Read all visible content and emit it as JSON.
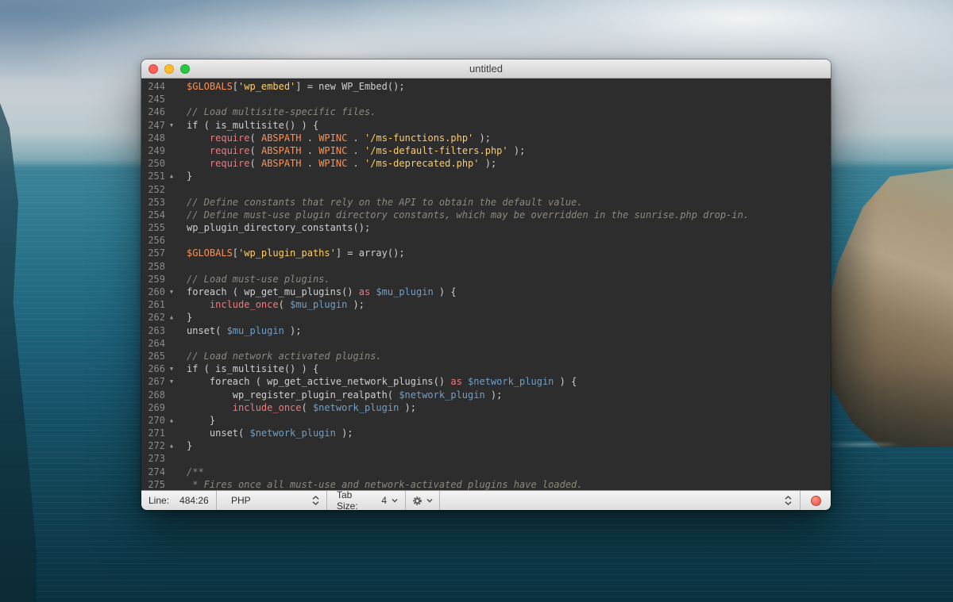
{
  "window": {
    "title": "untitled"
  },
  "editor": {
    "colors": {
      "background": "#2d2d2d",
      "foreground": "#cfcfcf",
      "comment": "#8d887c",
      "string": "#ffcc66",
      "keyword": "#f2777a",
      "constant": "#f99157",
      "variable": "#6f9fc8",
      "line_number": "#8a8a8a",
      "fold_marker": "#9a9a9a"
    },
    "lines": [
      {
        "n": 244,
        "fold": "",
        "seg": [
          [
            "$GLOBALS",
            "o"
          ],
          [
            "[",
            "f"
          ],
          [
            "'wp_embed'",
            "s"
          ],
          [
            "] = new WP_Embed();",
            "f"
          ]
        ]
      },
      {
        "n": 245,
        "fold": "",
        "seg": []
      },
      {
        "n": 246,
        "fold": "",
        "seg": [
          [
            "// Load multisite-specific files.",
            "c"
          ]
        ]
      },
      {
        "n": 247,
        "fold": "down",
        "seg": [
          [
            "if ( is_multisite() ) {",
            "f"
          ]
        ]
      },
      {
        "n": 248,
        "fold": "",
        "seg": [
          [
            "    ",
            "f"
          ],
          [
            "require",
            "k"
          ],
          [
            "( ",
            "f"
          ],
          [
            "ABSPATH",
            "o"
          ],
          [
            " . ",
            "f"
          ],
          [
            "WPINC",
            "o"
          ],
          [
            " . ",
            "f"
          ],
          [
            "'/ms-functions.php'",
            "s"
          ],
          [
            " );",
            "f"
          ]
        ]
      },
      {
        "n": 249,
        "fold": "",
        "seg": [
          [
            "    ",
            "f"
          ],
          [
            "require",
            "k"
          ],
          [
            "( ",
            "f"
          ],
          [
            "ABSPATH",
            "o"
          ],
          [
            " . ",
            "f"
          ],
          [
            "WPINC",
            "o"
          ],
          [
            " . ",
            "f"
          ],
          [
            "'/ms-default-filters.php'",
            "s"
          ],
          [
            " );",
            "f"
          ]
        ]
      },
      {
        "n": 250,
        "fold": "",
        "seg": [
          [
            "    ",
            "f"
          ],
          [
            "require",
            "k"
          ],
          [
            "( ",
            "f"
          ],
          [
            "ABSPATH",
            "o"
          ],
          [
            " . ",
            "f"
          ],
          [
            "WPINC",
            "o"
          ],
          [
            " . ",
            "f"
          ],
          [
            "'/ms-deprecated.php'",
            "s"
          ],
          [
            " );",
            "f"
          ]
        ]
      },
      {
        "n": 251,
        "fold": "up",
        "seg": [
          [
            "}",
            "f"
          ]
        ]
      },
      {
        "n": 252,
        "fold": "",
        "seg": []
      },
      {
        "n": 253,
        "fold": "",
        "seg": [
          [
            "// Define constants that rely on the API to obtain the default value.",
            "c"
          ]
        ]
      },
      {
        "n": 254,
        "fold": "",
        "seg": [
          [
            "// Define must-use plugin directory constants, which may be overridden in the sunrise.php drop-in.",
            "c"
          ]
        ]
      },
      {
        "n": 255,
        "fold": "",
        "seg": [
          [
            "wp_plugin_directory_constants();",
            "f"
          ]
        ]
      },
      {
        "n": 256,
        "fold": "",
        "seg": []
      },
      {
        "n": 257,
        "fold": "",
        "seg": [
          [
            "$GLOBALS",
            "o"
          ],
          [
            "[",
            "f"
          ],
          [
            "'wp_plugin_paths'",
            "s"
          ],
          [
            "] = array();",
            "f"
          ]
        ]
      },
      {
        "n": 258,
        "fold": "",
        "seg": []
      },
      {
        "n": 259,
        "fold": "",
        "seg": [
          [
            "// Load must-use plugins.",
            "c"
          ]
        ]
      },
      {
        "n": 260,
        "fold": "down",
        "seg": [
          [
            "foreach ( wp_get_mu_plugins() ",
            "f"
          ],
          [
            "as",
            "k"
          ],
          [
            " ",
            "f"
          ],
          [
            "$mu_plugin",
            "v"
          ],
          [
            " ) {",
            "f"
          ]
        ]
      },
      {
        "n": 261,
        "fold": "",
        "seg": [
          [
            "    ",
            "f"
          ],
          [
            "include_once",
            "k"
          ],
          [
            "( ",
            "f"
          ],
          [
            "$mu_plugin",
            "v"
          ],
          [
            " );",
            "f"
          ]
        ]
      },
      {
        "n": 262,
        "fold": "up",
        "seg": [
          [
            "}",
            "f"
          ]
        ]
      },
      {
        "n": 263,
        "fold": "",
        "seg": [
          [
            "unset( ",
            "f"
          ],
          [
            "$mu_plugin",
            "v"
          ],
          [
            " );",
            "f"
          ]
        ]
      },
      {
        "n": 264,
        "fold": "",
        "seg": []
      },
      {
        "n": 265,
        "fold": "",
        "seg": [
          [
            "// Load network activated plugins.",
            "c"
          ]
        ]
      },
      {
        "n": 266,
        "fold": "down",
        "seg": [
          [
            "if ( is_multisite() ) {",
            "f"
          ]
        ]
      },
      {
        "n": 267,
        "fold": "down",
        "seg": [
          [
            "    foreach ( wp_get_active_network_plugins() ",
            "f"
          ],
          [
            "as",
            "k"
          ],
          [
            " ",
            "f"
          ],
          [
            "$network_plugin",
            "v"
          ],
          [
            " ) {",
            "f"
          ]
        ]
      },
      {
        "n": 268,
        "fold": "",
        "seg": [
          [
            "        wp_register_plugin_realpath( ",
            "f"
          ],
          [
            "$network_plugin",
            "v"
          ],
          [
            " );",
            "f"
          ]
        ]
      },
      {
        "n": 269,
        "fold": "",
        "seg": [
          [
            "        ",
            "f"
          ],
          [
            "include_once",
            "k"
          ],
          [
            "( ",
            "f"
          ],
          [
            "$network_plugin",
            "v"
          ],
          [
            " );",
            "f"
          ]
        ]
      },
      {
        "n": 270,
        "fold": "up",
        "seg": [
          [
            "    }",
            "f"
          ]
        ]
      },
      {
        "n": 271,
        "fold": "",
        "seg": [
          [
            "    unset( ",
            "f"
          ],
          [
            "$network_plugin",
            "v"
          ],
          [
            " );",
            "f"
          ]
        ]
      },
      {
        "n": 272,
        "fold": "up",
        "seg": [
          [
            "}",
            "f"
          ]
        ]
      },
      {
        "n": 273,
        "fold": "",
        "seg": []
      },
      {
        "n": 274,
        "fold": "",
        "seg": [
          [
            "/**",
            "c"
          ]
        ]
      },
      {
        "n": 275,
        "fold": "",
        "seg": [
          [
            " * Fires once all must-use and network-activated plugins have loaded.",
            "c"
          ]
        ]
      }
    ]
  },
  "status_bar": {
    "line_label": "Line:",
    "line_value": "484:26",
    "language": "PHP",
    "tab_size_label": "Tab Size:",
    "tab_size_value": "4",
    "indicator_color": "#ef6a5e"
  }
}
